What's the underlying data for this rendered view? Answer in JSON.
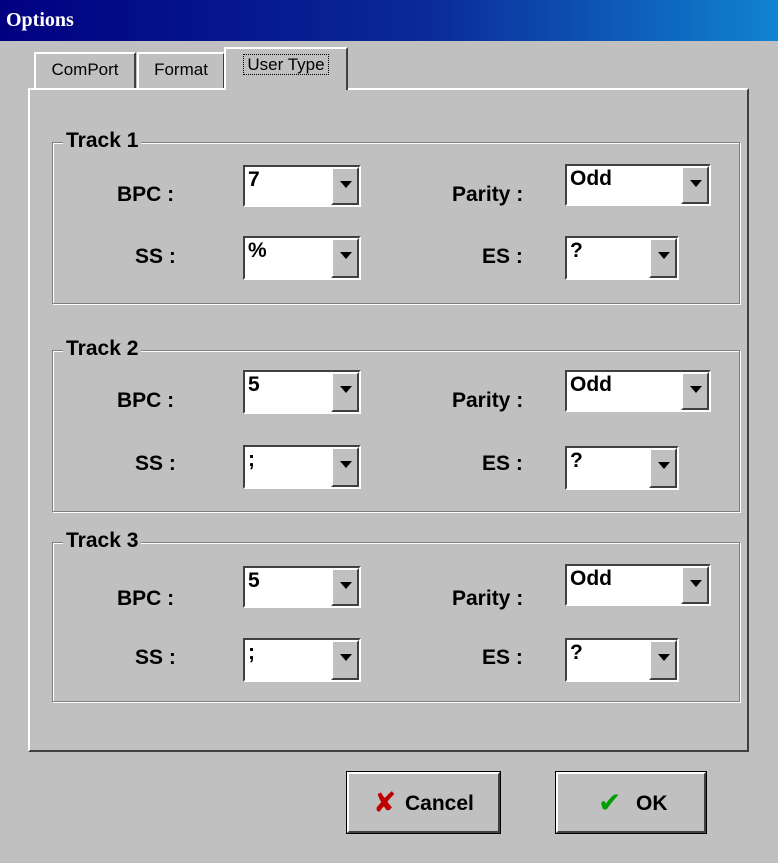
{
  "window": {
    "title": "Options"
  },
  "tabs": [
    "ComPort",
    "Format",
    "User Type"
  ],
  "labels": {
    "bpc": "BPC :",
    "parity": "Parity :",
    "ss": "SS :",
    "es": "ES :"
  },
  "tracks": [
    {
      "name": "Track 1",
      "bpc": "7",
      "parity": "Odd",
      "ss": "%",
      "es": "?"
    },
    {
      "name": "Track 2",
      "bpc": "5",
      "parity": "Odd",
      "ss": ";",
      "es": "?"
    },
    {
      "name": "Track 3",
      "bpc": "5",
      "parity": "Odd",
      "ss": ";",
      "es": "?"
    }
  ],
  "buttons": {
    "cancel": "Cancel",
    "ok": "OK"
  },
  "icons": {
    "cancel": "x-icon",
    "ok": "checkmark-icon"
  },
  "colors": {
    "title_bar": "#000080",
    "cancel_icon": "#c00000",
    "ok_icon": "#00a000",
    "face": "#c0c0c0"
  }
}
